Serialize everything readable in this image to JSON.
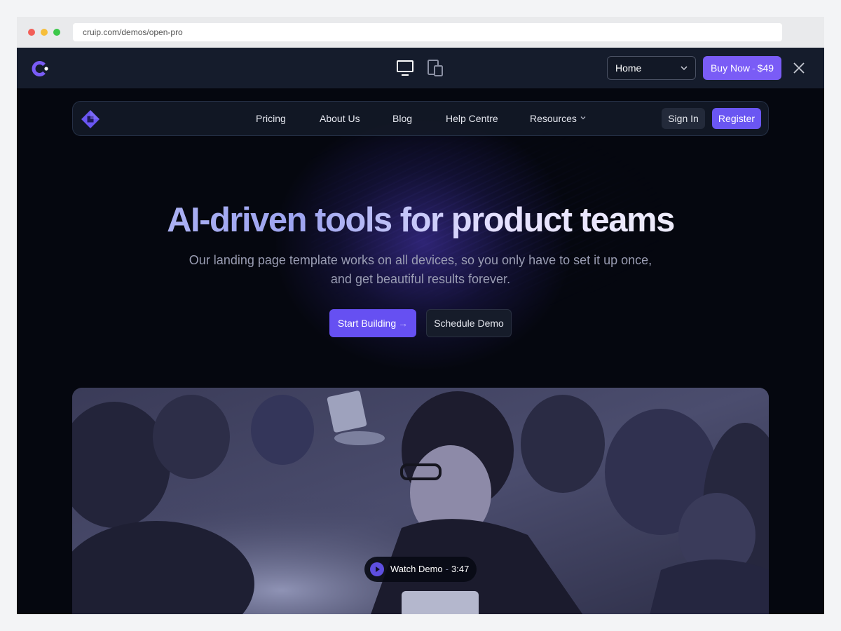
{
  "browser": {
    "url": "cruip.com/demos/open-pro"
  },
  "demo_bar": {
    "page_select_value": "Home",
    "buy_label": "Buy Now",
    "buy_price": "$49"
  },
  "site": {
    "nav": {
      "links": [
        "Pricing",
        "About Us",
        "Blog",
        "Help Centre",
        "Resources"
      ],
      "signin": "Sign In",
      "register": "Register"
    },
    "hero": {
      "title": "AI-driven tools for product teams",
      "subtitle_line1": "Our landing page template works on all devices, so you only have to set it up once,",
      "subtitle_line2": "and get beautiful results forever.",
      "primary_cta": "Start Building",
      "secondary_cta": "Schedule Demo"
    },
    "video": {
      "watch_label": "Watch Demo",
      "duration": "3:47"
    }
  },
  "colors": {
    "accent": "#6a56f2",
    "background": "#05070f",
    "toolbar": "#151c2c"
  },
  "icons": [
    "cruip-logo-icon",
    "desktop-icon",
    "mobile-icon",
    "chevron-down-icon",
    "close-icon",
    "site-logo-icon",
    "arrow-right-icon",
    "play-icon"
  ]
}
